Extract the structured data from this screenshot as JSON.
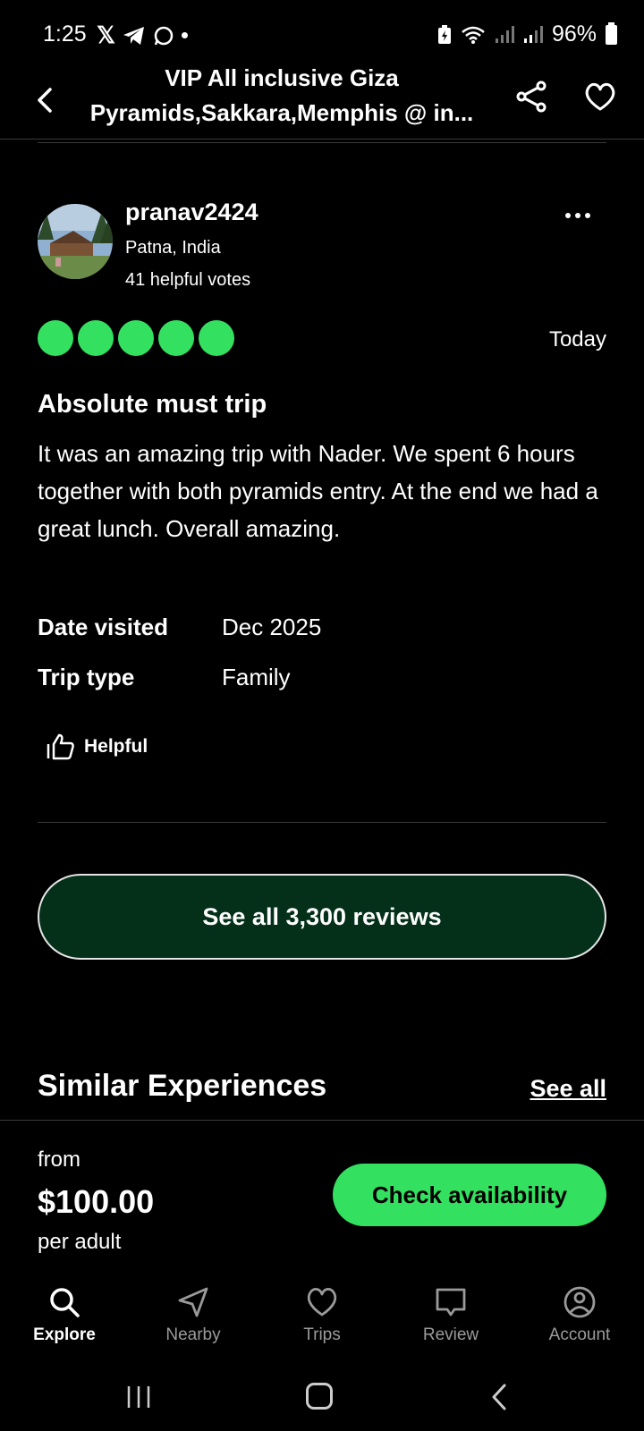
{
  "status_bar": {
    "time": "1:25",
    "battery": "96%",
    "left_icons": [
      "x-icon",
      "telegram-icon",
      "whatsapp-icon",
      "dot-icon"
    ],
    "right_icons": [
      "battery-saver-icon",
      "wifi-icon",
      "signal-icon",
      "signal-icon",
      "battery-icon"
    ]
  },
  "header": {
    "title_line1": "VIP All inclusive Giza",
    "title_line2": "Pyramids,Sakkara,Memphis @ in..."
  },
  "review": {
    "username": "pranav2424",
    "location": "Patna, India",
    "helpful_votes": "41 helpful votes",
    "rating": 5,
    "date": "Today",
    "title": "Absolute must trip",
    "body": "It was an amazing trip with Nader. We spent 6 hours together with both pyramids entry. At the end we had a great lunch. Overall amazing.",
    "date_visited_label": "Date visited",
    "date_visited_value": "Dec 2025",
    "trip_type_label": "Trip type",
    "trip_type_value": "Family",
    "helpful_label": "Helpful"
  },
  "see_all_reviews_label": "See all 3,300 reviews",
  "similar": {
    "title": "Similar Experiences",
    "see_all_label": "See all"
  },
  "booking": {
    "from_label": "from",
    "price": "$100.00",
    "per_label": "per adult",
    "cta_label": "Check availability"
  },
  "tabs": [
    {
      "label": "Explore",
      "icon": "search-icon",
      "active": true
    },
    {
      "label": "Nearby",
      "icon": "navigation-arrow-icon",
      "active": false
    },
    {
      "label": "Trips",
      "icon": "heart-icon",
      "active": false
    },
    {
      "label": "Review",
      "icon": "speech-bubble-icon",
      "active": false
    },
    {
      "label": "Account",
      "icon": "person-icon",
      "active": false
    }
  ],
  "colors": {
    "accent_green": "#34e060",
    "dark_green_button": "#04301a",
    "background": "#000000"
  }
}
